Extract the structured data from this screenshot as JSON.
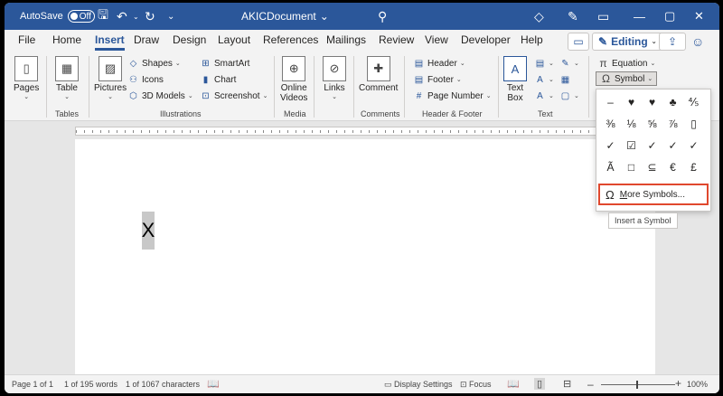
{
  "titlebar": {
    "autosave_label": "AutoSave",
    "autosave_state": "Off",
    "doc_title": "AKICDocument",
    "doc_title_caret": "⌄"
  },
  "tabs": [
    "File",
    "Home",
    "Insert",
    "Draw",
    "Design",
    "Layout",
    "References",
    "Mailings",
    "Review",
    "View",
    "Developer",
    "Help"
  ],
  "active_tab": "Insert",
  "editing_label": "Editing",
  "ribbon": {
    "pages": "Pages",
    "table": "Table",
    "pictures": "Pictures",
    "shapes": "Shapes",
    "icons": "Icons",
    "models": "3D Models",
    "smartart": "SmartArt",
    "chart": "Chart",
    "screenshot": "Screenshot",
    "online_videos_1": "Online",
    "online_videos_2": "Videos",
    "links": "Links",
    "comment": "Comment",
    "header": "Header",
    "footer": "Footer",
    "page_number": "Page Number",
    "text_box_1": "Text",
    "text_box_2": "Box",
    "equation": "Equation",
    "symbol": "Symbol",
    "groups": {
      "tables": "Tables",
      "illustrations": "Illustrations",
      "media": "Media",
      "comments": "Comments",
      "header_footer": "Header & Footer",
      "text": "Text"
    }
  },
  "document": {
    "content": "X"
  },
  "symbols": [
    "–",
    "♥",
    "♥",
    "♣",
    "⅘",
    "⅜",
    "⅛",
    "⅝",
    "⅞",
    "▯",
    "✓",
    "☑",
    "✓",
    "✓",
    "✓",
    "Ã",
    "□",
    "⊆",
    "€",
    "£"
  ],
  "more_symbols": {
    "icon": "Ω",
    "prefix": "M",
    "rest": "ore Symbols..."
  },
  "tooltip": "Insert a Symbol",
  "status": {
    "page": "Page 1 of 1",
    "words": "1 of 195 words",
    "chars": "1 of 1067 characters",
    "display_settings": "Display Settings",
    "focus": "Focus",
    "zoom": "100%"
  }
}
